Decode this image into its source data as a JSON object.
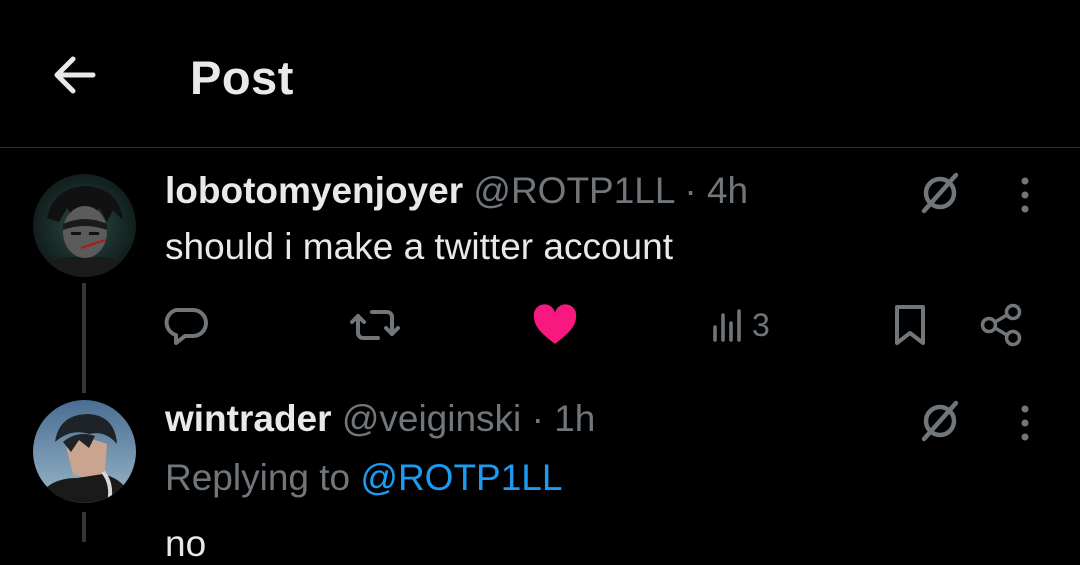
{
  "header": {
    "title": "Post"
  },
  "tweet1": {
    "display_name": "lobotomyenjoyer",
    "handle": "@ROTP1LL",
    "separator": "·",
    "time": "4h",
    "text": "should i make a twitter account",
    "actions": {
      "views_count": "3",
      "liked": true,
      "like_color": "#f91880"
    }
  },
  "tweet2": {
    "display_name": "wintrader",
    "handle": "@veiginski",
    "separator": "·",
    "time": "1h",
    "replying_prefix": "Replying to",
    "replying_mention": "@ROTP1LL",
    "partial_text": "no"
  },
  "colors": {
    "background": "#000000",
    "primary_text": "#e7e9ea",
    "secondary_text": "#71767b",
    "link": "#1d9bf0",
    "like": "#f91880",
    "divider": "#2f3336"
  }
}
